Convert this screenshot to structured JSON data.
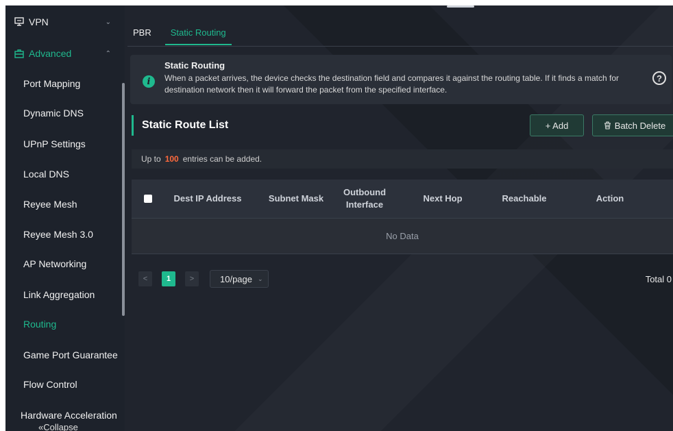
{
  "sidebar": {
    "vpn_label": "VPN",
    "advanced_label": "Advanced",
    "items": [
      {
        "label": "Port Mapping"
      },
      {
        "label": "Dynamic DNS"
      },
      {
        "label": "UPnP Settings"
      },
      {
        "label": "Local DNS"
      },
      {
        "label": "Reyee Mesh"
      },
      {
        "label": "Reyee Mesh 3.0"
      },
      {
        "label": "AP Networking"
      },
      {
        "label": "Link Aggregation"
      },
      {
        "label": "Routing"
      },
      {
        "label": "Game Port Guarantee"
      },
      {
        "label": "Flow Control"
      },
      {
        "label": "Hardware Acceleration"
      }
    ],
    "collapse_label": "«Collapse"
  },
  "tabs": [
    {
      "label": "PBR"
    },
    {
      "label": "Static Routing"
    }
  ],
  "notice": {
    "title": "Static Routing",
    "text": "When a packet arrives, the device checks the destination field and compares it against the routing table. If it finds a match for destination network then it will forward the packet from the specified interface."
  },
  "section": {
    "title": "Static Route List",
    "add_label": "+ Add",
    "batch_delete_label": "Batch Delete"
  },
  "limit": {
    "prefix": "Up to",
    "count": "100",
    "suffix": "entries can be added."
  },
  "table": {
    "columns": [
      "Dest IP Address",
      "Subnet Mask",
      "Outbound Interface",
      "Next Hop",
      "Reachable",
      "Action"
    ],
    "empty_text": "No Data"
  },
  "pagination": {
    "prev": "<",
    "current_page": "1",
    "next": ">",
    "page_size": "10/page",
    "total": "Total 0"
  },
  "colors": {
    "accent": "#1fb98e",
    "highlight_number": "#ff6a3d",
    "background": "#1c2029"
  },
  "icons": {
    "vpn": "monitor-icon",
    "advanced": "briefcase-icon",
    "info": "info-icon",
    "help": "question-circle-icon",
    "batch_delete": "trash-icon"
  }
}
